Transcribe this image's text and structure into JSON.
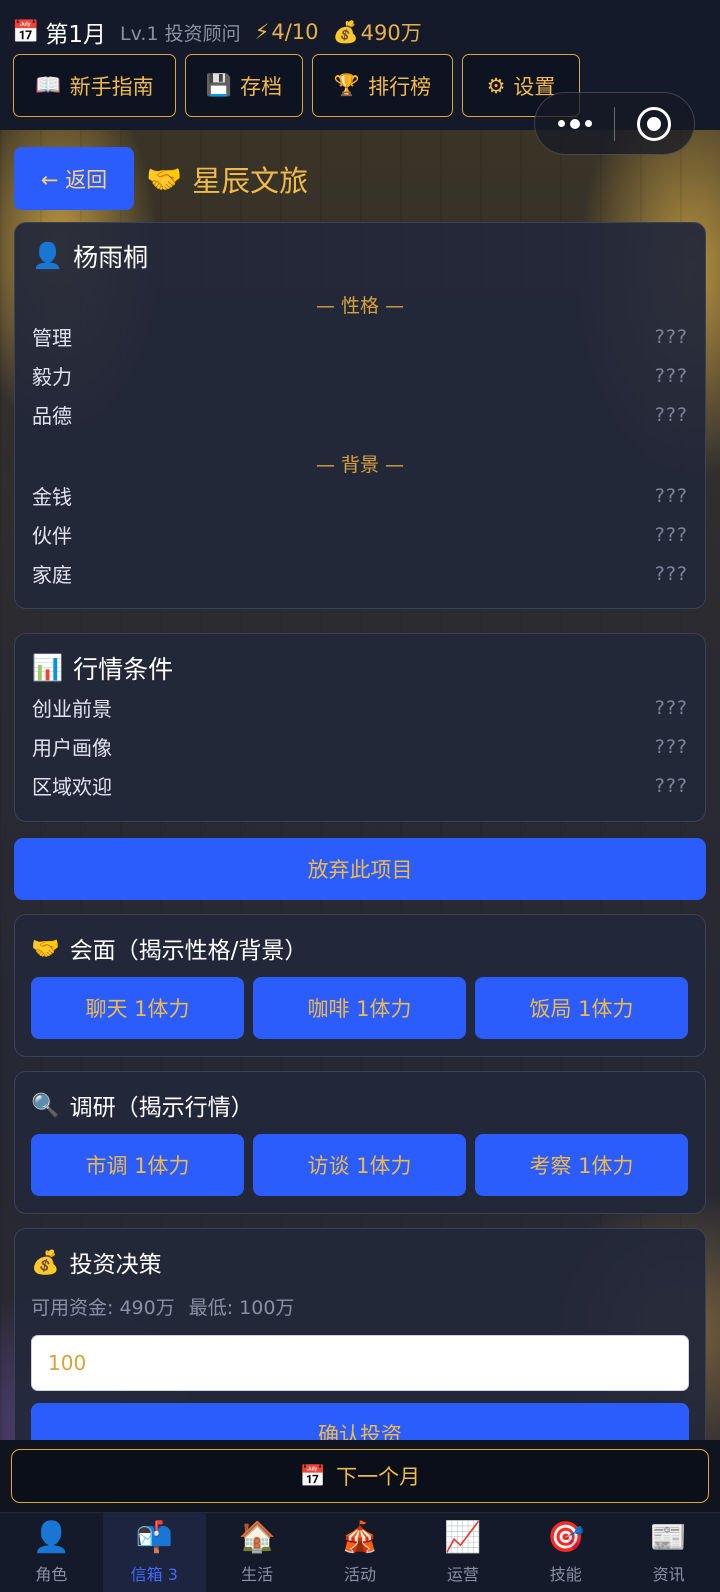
{
  "status": {
    "calendar_icon": "📅",
    "month": "第1月",
    "level": "Lv.1 投资顾问",
    "energy_icon": "⚡",
    "energy": "4/10",
    "money_icon": "💰",
    "money": "490万"
  },
  "menu": [
    {
      "icon": "📖",
      "label": "新手指南"
    },
    {
      "icon": "💾",
      "label": "存档"
    },
    {
      "icon": "🏆",
      "label": "排行榜"
    },
    {
      "icon": "⚙",
      "label": "设置"
    }
  ],
  "header": {
    "back_label": "← 返回",
    "project_icon": "🤝",
    "project_name": "星辰文旅"
  },
  "person": {
    "icon": "👤",
    "name": "杨雨桐",
    "personality_title": "— 性格 —",
    "personality": [
      {
        "label": "管理",
        "value": "???"
      },
      {
        "label": "毅力",
        "value": "???"
      },
      {
        "label": "品德",
        "value": "???"
      }
    ],
    "background_title": "— 背景 —",
    "background": [
      {
        "label": "金钱",
        "value": "???"
      },
      {
        "label": "伙伴",
        "value": "???"
      },
      {
        "label": "家庭",
        "value": "???"
      }
    ]
  },
  "market": {
    "icon": "📊",
    "title": "行情条件",
    "items": [
      {
        "label": "创业前景",
        "value": "???"
      },
      {
        "label": "用户画像",
        "value": "???"
      },
      {
        "label": "区域欢迎",
        "value": "???"
      }
    ]
  },
  "abandon_label": "放弃此项目",
  "meeting": {
    "icon": "🤝",
    "title": "会面（揭示性格/背景）",
    "actions": [
      "聊天 1体力",
      "咖啡 1体力",
      "饭局 1体力"
    ]
  },
  "research": {
    "icon": "🔍",
    "title": "调研（揭示行情）",
    "actions": [
      "市调 1体力",
      "访谈 1体力",
      "考察 1体力"
    ]
  },
  "invest": {
    "icon": "💰",
    "title": "投资决策",
    "available": "可用资金: 490万",
    "minimum": "最低: 100万",
    "input_value": "100",
    "confirm_label": "确认投资"
  },
  "next_month": {
    "icon": "📅",
    "label": "下一个月"
  },
  "tabs": [
    {
      "icon": "👤",
      "label": "角色",
      "active": false
    },
    {
      "icon": "📬",
      "label": "信箱 3",
      "active": true
    },
    {
      "icon": "🏠",
      "label": "生活",
      "active": false
    },
    {
      "icon": "🎪",
      "label": "活动",
      "active": false
    },
    {
      "icon": "📈",
      "label": "运营",
      "active": false
    },
    {
      "icon": "🎯",
      "label": "技能",
      "active": false
    },
    {
      "icon": "📰",
      "label": "资讯",
      "active": false
    }
  ],
  "colors": {
    "accent_blue": "#2a5dfb",
    "gold": "#f0b94a",
    "card_bg": "#22283a",
    "active_tab": "#3f6bff"
  }
}
